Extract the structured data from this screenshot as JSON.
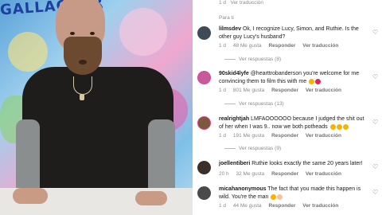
{
  "video": {
    "background_text": "GALLAGHER"
  },
  "top": {
    "prev_time": "1 d",
    "prev_translate": "Ver traducción",
    "para_ti": "Para ti"
  },
  "comments": [
    {
      "username": "lilmsdev",
      "text": "Ok, I recognize Lucy, Simon, and Ruthie. Is the other guy Lucy's husband?",
      "time": "1 d",
      "likes": "48 Me gusta",
      "reply_label": "Responder",
      "translate_label": "Ver traducción",
      "replies_label": "Ver respuestas (8)",
      "avatar_color": "#3f4a57"
    },
    {
      "username": "90skid4lyfe",
      "text": "@hearttrobanderson you're welcome for me convincing them to film this with me",
      "emojis": [
        "#f4b400",
        "#e0245e"
      ],
      "time": "1 d",
      "likes": "801 Me gusta",
      "reply_label": "Responder",
      "translate_label": "Ver traducción",
      "replies_label": "Ver respuestas (13)",
      "avatar_color": "#c45b9a"
    },
    {
      "username": "realrightjah",
      "text": "LMFAOOOOOO because I judged the shit out of her when I was 9.. now we both potheads",
      "emojis": [
        "#f4b400",
        "#f4b400",
        "#f4b400"
      ],
      "time": "1 d",
      "likes": "191 Me gusta",
      "reply_label": "Responder",
      "translate_label": "Ver traducción",
      "replies_label": "Ver respuestas (9)",
      "avatar_color": "#7a5a3a"
    },
    {
      "username": "joellentiberi",
      "text": "Ruthie looks exactly the same 20 years later!",
      "time": "20 h",
      "likes": "32 Me gusta",
      "reply_label": "Responder",
      "translate_label": "Ver traducción",
      "avatar_color": "#3b2f2a"
    },
    {
      "username": "micahanonymous",
      "text": "The fact that you made this happen is wild. You're the man",
      "emojis": [
        "#f4b400",
        "#f2c4a0"
      ],
      "time": "1 d",
      "likes": "44 Me gusta",
      "reply_label": "Responder",
      "translate_label": "Ver traducción",
      "avatar_color": "#4a4a4a"
    }
  ],
  "icons": {
    "like": "heart-outline-icon"
  }
}
